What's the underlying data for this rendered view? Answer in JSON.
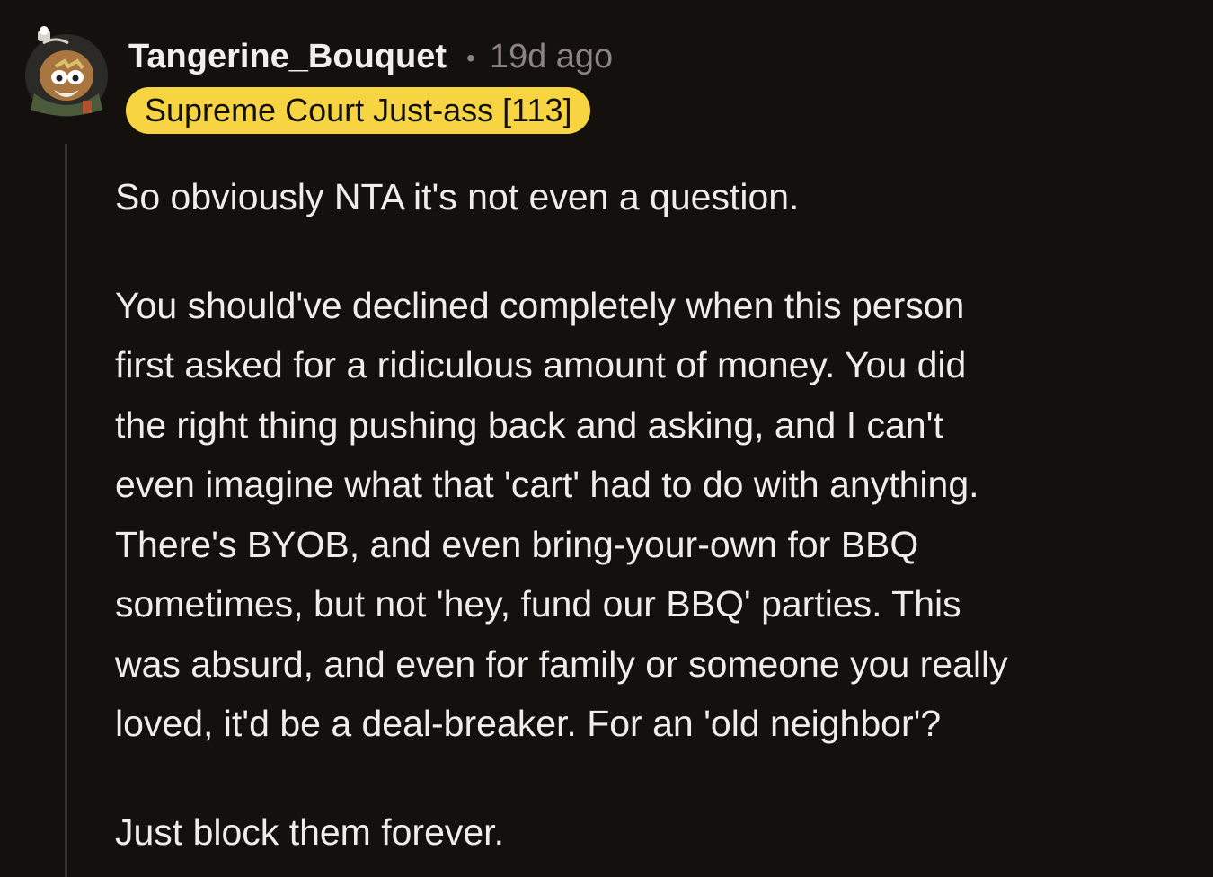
{
  "comment": {
    "author": "Tangerine_Bouquet",
    "separator": "•",
    "age": "19d ago",
    "flair": "Supreme Court Just-ass [113]",
    "paragraphs": [
      "So obviously NTA it's not even a question.",
      "You should've declined completely when this person\nfirst asked for a ridiculous amount of money. You did\nthe right thing pushing back and asking, and I can't\neven imagine what that 'cart' had to do with anything.\nThere's BYOB, and even bring-your-own for BBQ\nsometimes, but not 'hey, fund our BBQ' parties. This\nwas absurd, and even for family or someone you really\nloved, it'd be a deal-breaker. For an 'old neighbor'?",
      "Just block them forever."
    ]
  },
  "colors": {
    "background": "#14100e",
    "flair_background": "#f7d542",
    "flair_text": "#14100e",
    "meta_text": "#8c8480",
    "thread_line": "#3a3431"
  }
}
